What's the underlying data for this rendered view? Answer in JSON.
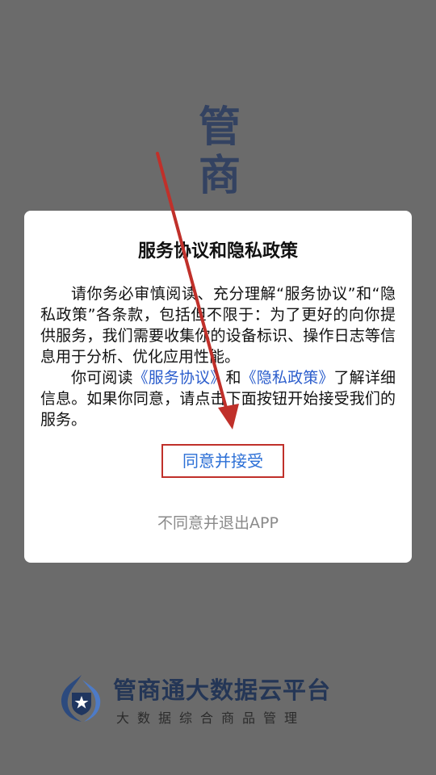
{
  "splash": {
    "title_chars": [
      "管",
      "商"
    ]
  },
  "dialog": {
    "title": "服务协议和隐私政策",
    "paragraph1": "请你务必审慎阅读、充分理解“服务协议”和“隐私政策”各条款，包括但不限于：为了更好的向你提供服务，我们需要收集你的设备标识、操作日志等信息用于分析、优化应用性能。",
    "paragraph2_prefix": "你可阅读",
    "service_link": "《服务协议》",
    "paragraph2_and": "和",
    "privacy_link": "《隐私政策》",
    "paragraph2_suffix": "了解详细信息。如果你同意，请点击下面按钮开始接受我们的服务。",
    "agree_label": "同意并接受",
    "decline_label": "不同意并退出APP"
  },
  "brand": {
    "name": "管商通大数据云平台",
    "subtitle": "大数据综合商品管理"
  },
  "colors": {
    "overlay": "#6b6b6b",
    "link": "#2b5dcc",
    "agree_text": "#2b6fd6",
    "annotation_red": "#c0302a",
    "brand_navy": "#243656"
  }
}
